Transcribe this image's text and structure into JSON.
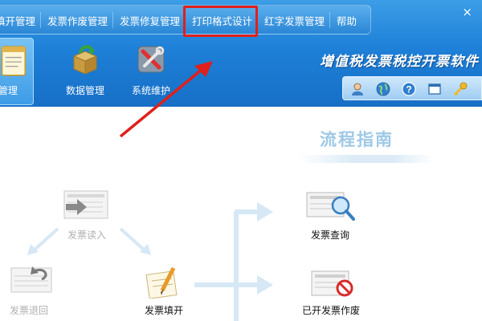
{
  "menu": {
    "items": [
      {
        "label": "填开管理"
      },
      {
        "label": "发票作废管理"
      },
      {
        "label": "发票修复管理"
      },
      {
        "label": "打印格式设计"
      },
      {
        "label": "红字发票管理"
      },
      {
        "label": "帮助"
      }
    ],
    "close_glyph": "×"
  },
  "nav": {
    "items": [
      {
        "label": "管理",
        "icon": "invoice-book-icon"
      },
      {
        "label": "数据管理",
        "icon": "data-box-icon"
      },
      {
        "label": "系统维护",
        "icon": "tools-icon"
      }
    ]
  },
  "brand": {
    "title": "增值税发票税控开票软件"
  },
  "toolbar": {
    "icons": [
      "user-icon",
      "globe-icon",
      "help-icon",
      "window-icon",
      "key-icon"
    ]
  },
  "guide": {
    "title": "流程指南",
    "steps": {
      "read_in": "发票读入",
      "return": "发票退回",
      "issue": "发票填开",
      "query": "发票查询",
      "void": "已开发票作废"
    }
  },
  "colors": {
    "header_blue": "#1e80d8",
    "highlight_red": "#e0201a",
    "flow_arrow": "#d6e8f5",
    "muted_text": "#b0b0b0"
  }
}
